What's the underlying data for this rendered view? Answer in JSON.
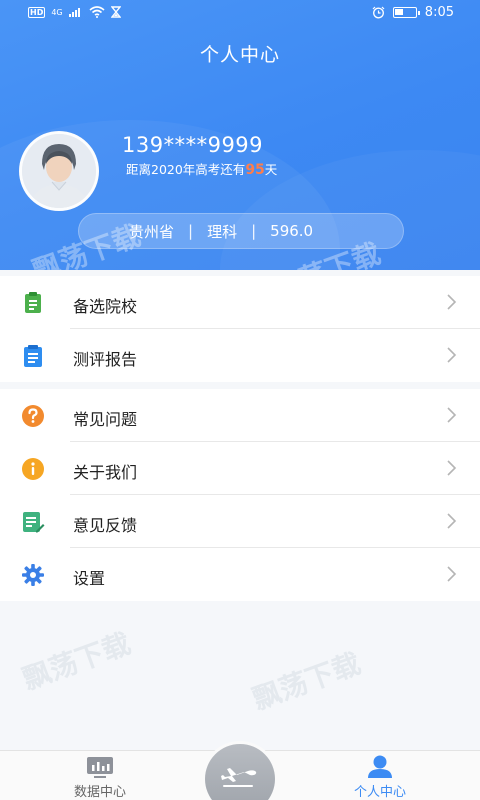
{
  "status_bar": {
    "left_badge": "HD",
    "network": "4G",
    "time": "8:05"
  },
  "header": {
    "title": "个人中心",
    "phone": "139****9999",
    "countdown_prefix": "距离2020年高考还有",
    "countdown_days": "95",
    "countdown_suffix": "天",
    "province": "贵州省",
    "subject": "理科",
    "score": "596.0"
  },
  "menu_group1": [
    {
      "label": "备选院校",
      "icon": "clipboard-green-icon"
    },
    {
      "label": "测评报告",
      "icon": "report-blue-icon"
    }
  ],
  "menu_group2": [
    {
      "label": "常见问题",
      "icon": "question-orange-icon"
    },
    {
      "label": "关于我们",
      "icon": "info-orange-icon"
    },
    {
      "label": "意见反馈",
      "icon": "feedback-green-icon"
    },
    {
      "label": "设置",
      "icon": "gear-blue-icon"
    }
  ],
  "tabbar": {
    "data_center": "数据中心",
    "personal_center": "个人中心"
  },
  "watermark": "飘荡下载",
  "colors": {
    "primary": "#3c8bf3",
    "accent": "#ff7d4a",
    "green": "#4cb04c",
    "orange": "#f28a2e"
  }
}
